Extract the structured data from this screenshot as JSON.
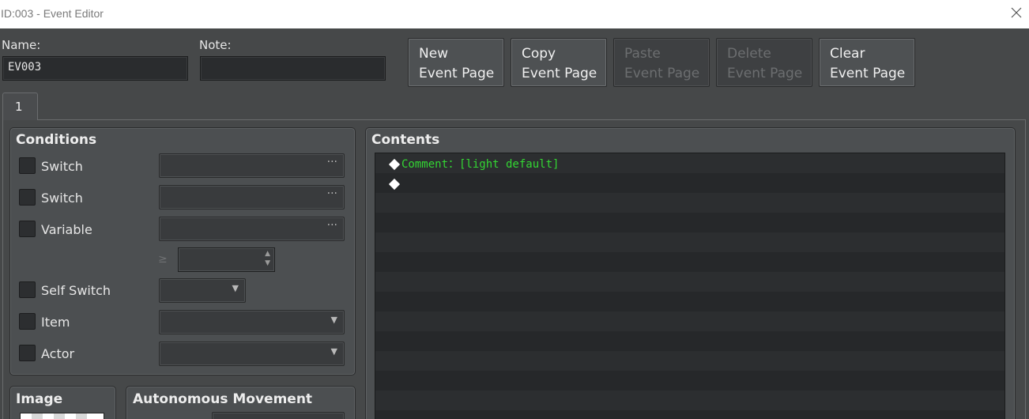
{
  "window": {
    "title": "ID:003 - Event Editor",
    "close_icon": "close-icon"
  },
  "header": {
    "name_label": "Name:",
    "name_value": "EV003",
    "note_label": "Note:",
    "note_value": ""
  },
  "buttons": [
    {
      "line1": "New",
      "line2": "Event Page",
      "enabled": true
    },
    {
      "line1": "Copy",
      "line2": "Event Page",
      "enabled": true
    },
    {
      "line1": "Paste",
      "line2": "Event Page",
      "enabled": false
    },
    {
      "line1": "Delete",
      "line2": "Event Page",
      "enabled": false
    },
    {
      "line1": "Clear",
      "line2": "Event Page",
      "enabled": true
    }
  ],
  "tabs": [
    {
      "label": "1",
      "active": true
    }
  ],
  "conditions": {
    "title": "Conditions",
    "switch1": {
      "label": "Switch",
      "value": "",
      "button": "···"
    },
    "switch2": {
      "label": "Switch",
      "value": "",
      "button": "···"
    },
    "variable": {
      "label": "Variable",
      "value": "",
      "button": "···",
      "operator": "≥",
      "amount": ""
    },
    "self_switch": {
      "label": "Self Switch",
      "value": ""
    },
    "item": {
      "label": "Item",
      "value": ""
    },
    "actor": {
      "label": "Actor",
      "value": ""
    }
  },
  "image_panel": {
    "title": "Image"
  },
  "movement_panel": {
    "title": "Autonomous Movement"
  },
  "contents": {
    "title": "Contents",
    "commands": [
      {
        "text": "Comment：[light default]"
      },
      {
        "text": ""
      }
    ]
  },
  "colors": {
    "comment_text": "#33d633",
    "background": "#464849",
    "list_bg": "#26282a"
  }
}
